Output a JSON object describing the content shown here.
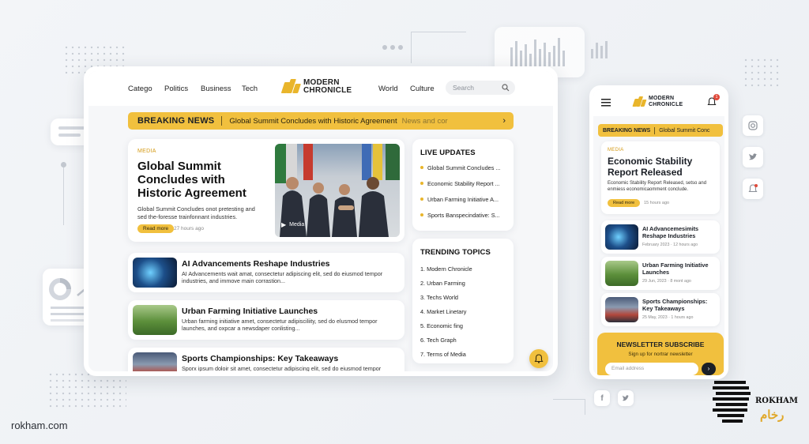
{
  "colors": {
    "accent": "#f1c03e",
    "tag": "#d49a16",
    "text": "#1b1f26"
  },
  "desktop": {
    "nav_left": [
      "Catego",
      "Politics",
      "Business",
      "Tech"
    ],
    "nav_right": [
      "World",
      "Culture"
    ],
    "logo": {
      "line1": "MODERN",
      "line2": "CHRONICLE"
    },
    "search": {
      "placeholder": "Search",
      "icon": "search-icon"
    },
    "breaking": {
      "title": "BREAKING NEWS",
      "text": "Global Summit Concludes with Historic Agreement",
      "fade": "News and cor",
      "icon": "chevron-right-icon"
    },
    "featured": {
      "tag": "MEDIA",
      "headline": "Global Summit Concludes with Historic Agreement",
      "summary": "Global Summit Concludes onot pretesting and sed the-foresse trainfonnant industries.",
      "button": "Read more",
      "time": "27 hours ago",
      "media_label": "Media",
      "media_icon": "play-icon"
    },
    "articles": [
      {
        "title": "AI Advancements Reshape Industries",
        "summary": "AI Advancements wait amat, consectetur adipiscing elit, sed do eiusmod tempor industries, and immove main corrastion...",
        "image": "ai-brain-image"
      },
      {
        "title": "Urban Farming Initiative Launches",
        "summary": "Urban farming initiative amet, consectetur adipisciliity, sed do elusmod tempor launches, and oxpcar a newsdaper conlisting...",
        "image": "farming-image"
      },
      {
        "title": "Sports Championships: Key Takeaways",
        "summary": "Sporx ipsum doloir sit amet, consectetur adipiscing elit, sed do eiusmod tempor industries, and immove main commision...",
        "image": "sports-image"
      }
    ],
    "live": {
      "title": "LIVE UPDATES",
      "items": [
        "Global Summit Concludes ...",
        "Economic Stability Report ...",
        "Urban Farming Initiative A...",
        "Sports Banspecindative: S..."
      ]
    },
    "trending": {
      "title": "TRENDING TOPICS",
      "items": [
        "1. Modern Chronicle",
        "2. Urban Farming",
        "3. Techs World",
        "4. Market Linetary",
        "5. Economic fing",
        "6. Tech Graph",
        "7. Terms of Media"
      ]
    },
    "fab_icon": "bell-icon"
  },
  "mobile": {
    "logo": {
      "line1": "MODERN",
      "line2": "CHRONICLE"
    },
    "menu_icon": "hamburger-icon",
    "bell_icon": "bell-icon",
    "bell_badge": "1",
    "breaking": {
      "title": "BREAKING NEWS",
      "text": "Global Summit Conc"
    },
    "featured": {
      "tag": "MEDIA",
      "headline": "Economic Stability Report Released",
      "summary": "Economic Stability Report Released, setso and enmiess economicaomment conclude.",
      "button": "Read more",
      "time": "15 hours ago"
    },
    "articles": [
      {
        "title": "AI Advancemesimits Reshape Industries",
        "meta": "February 2023 · 12 hours ago",
        "image": "ai-brain-image"
      },
      {
        "title": "Urban Farming Initiative Launches",
        "meta": "29 Jun, 2023 · 8 mont ago",
        "image": "farming-image"
      },
      {
        "title": "Sports Championships: Key Takeaways",
        "meta": "25 May, 2023 · 1 hours ago",
        "image": "sports-image"
      }
    ],
    "newsletter": {
      "title": "NEWSLETTER SUBSCRIBE",
      "subtitle": "Sign up for nortrar newsletter",
      "placeholder": "Email address"
    }
  },
  "social_icons": [
    "instagram-icon",
    "twitter-icon",
    "bell-icon"
  ],
  "footer_icons": [
    "facebook-icon",
    "twitter-icon"
  ],
  "watermark": {
    "site": "rokham.com",
    "brand": "ROKHAM",
    "brand_fa": "رخام"
  }
}
